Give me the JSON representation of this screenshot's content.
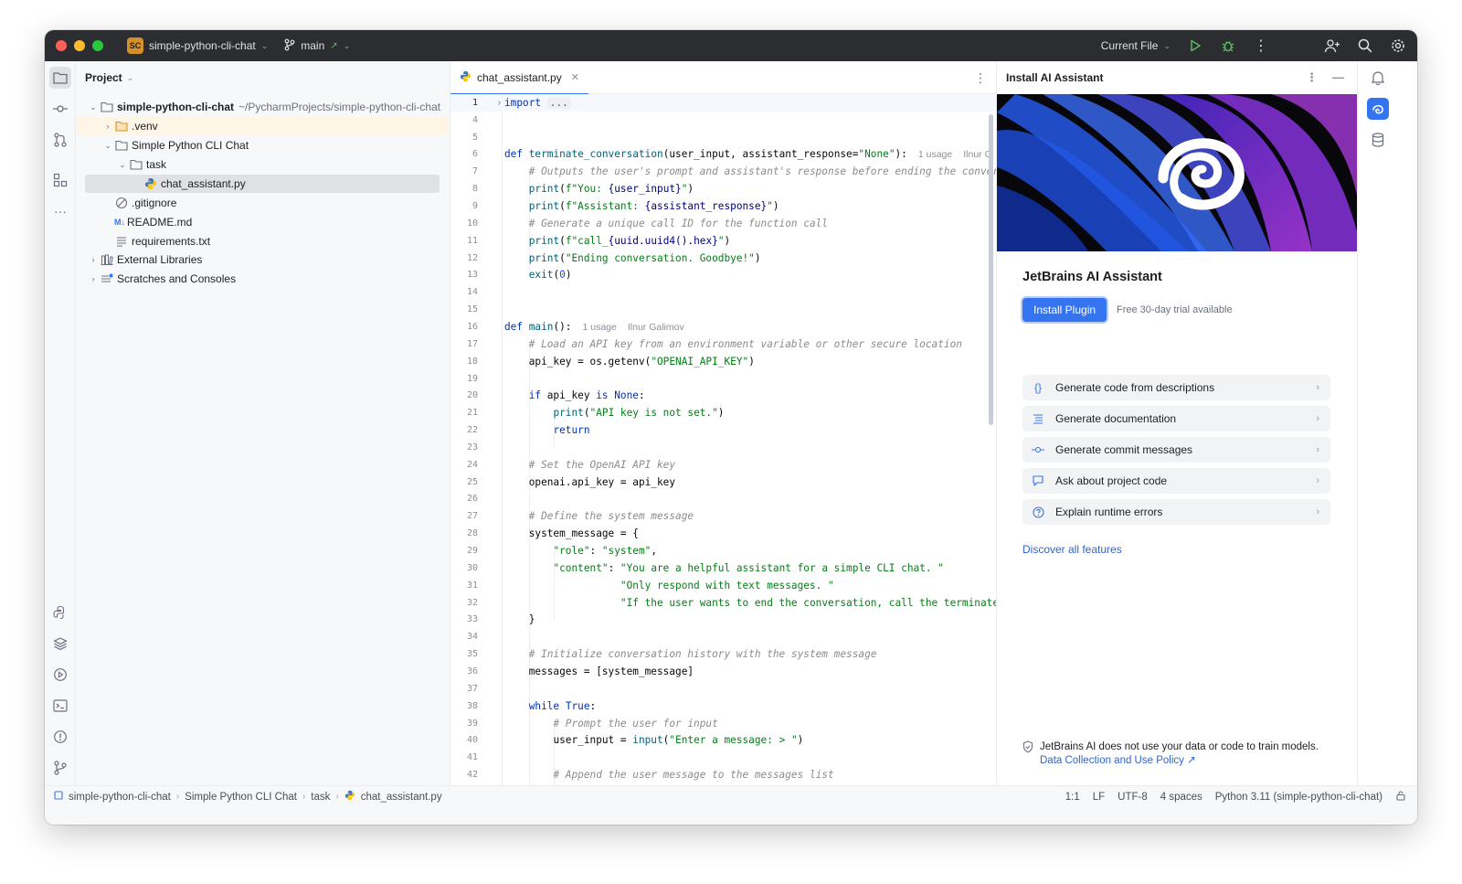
{
  "titlebar": {
    "project_badge": "SC",
    "project_name": "simple-python-cli-chat",
    "branch": "main",
    "run_config": "Current File"
  },
  "project_panel": {
    "title": "Project",
    "root_name": "simple-python-cli-chat",
    "root_path": "~/PycharmProjects/simple-python-cli-chat",
    "items": {
      "venv": ".venv",
      "folder_chat": "Simple Python CLI Chat",
      "folder_task": "task",
      "file_main": "chat_assistant.py",
      "gitignore": ".gitignore",
      "readme_prefix": "M↓",
      "readme": "README.md",
      "requirements": "requirements.txt",
      "external_libs": "External Libraries",
      "scratches": "Scratches and Consoles"
    }
  },
  "editor": {
    "tab_label": "chat_assistant.py",
    "hints": {
      "usage": "1 usage",
      "author": "Ilnur Galimov",
      "author_short": "Ilnur G"
    },
    "lines": {
      "n1": "1",
      "n4": "4",
      "n5": "5",
      "n6": "6",
      "n7": "7",
      "n8": "8",
      "n9": "9",
      "n10": "10",
      "n11": "11",
      "n12": "12",
      "n13": "13",
      "n14": "14",
      "n15": "15",
      "n16": "16",
      "n17": "17",
      "n18": "18",
      "n19": "19",
      "n20": "20",
      "n21": "21",
      "n22": "22",
      "n23": "23",
      "n24": "24",
      "n25": "25",
      "n26": "26",
      "n27": "27",
      "n28": "28",
      "n29": "29",
      "n30": "30",
      "n31": "31",
      "n32": "32",
      "n33": "33",
      "n34": "34",
      "n35": "35",
      "n36": "36",
      "n37": "37",
      "n38": "38",
      "n39": "39",
      "n40": "40",
      "n41": "41",
      "n42": "42"
    },
    "code": {
      "import_kw": "import",
      "import_fold": "...",
      "def": "def",
      "fn_terminate": "terminate_conversation",
      "terminate_params_a": "(user_input, assistant_response=",
      "none_str": "\"None\"",
      "terminate_params_b": "):",
      "c7": "# Outputs the user's prompt and assistant's response before ending the conversation",
      "print": "print",
      "l8_a": "(",
      "l8_str1": "f\"You: ",
      "l8_sp": "{user_input}",
      "l8_str2": "\"",
      "l8_b": ")",
      "l9_str1": "f\"Assistant: ",
      "l9_sp": "{assistant_response}",
      "c10": "# Generate a unique call ID for the function call",
      "l11_str1": "f\"call_",
      "l11_sp": "{uuid.uuid4().hex}",
      "l12_str": "\"Ending conversation. Goodbye!\"",
      "exit": "exit",
      "zero": "0",
      "fn_main": "main",
      "main_params": "():",
      "c17": "# Load an API key from an environment variable or other secure location",
      "l18_a": "api_key = os.getenv(",
      "l18_str": "\"OPENAI_API_KEY\"",
      "if": "if",
      "l20_a": " api_key ",
      "is": "is",
      "none": "None",
      "colon": ":",
      "l21_str": "\"API key is not set.\"",
      "return": "return",
      "c24": "# Set the OpenAI API key",
      "l25": "openai.api_key = api_key",
      "c27": "# Define the system message",
      "l28": "system_message = {",
      "l29_k": "\"role\"",
      "l29_sep": ": ",
      "l29_v": "\"system\"",
      "comma": ",",
      "l30_k": "\"content\"",
      "l30_v": "\"You are a helpful assistant for a simple CLI chat. \"",
      "l31_v": "\"Only respond with text messages. \"",
      "l32_v": "\"If the user wants to end the conversation, call the terminate_conversation function.\"",
      "l33": "}",
      "c35": "# Initialize conversation history with the system message",
      "l36": "messages = [system_message]",
      "while": "while",
      "true": "True",
      "c39": "# Prompt the user for input",
      "l40_a": "user_input = ",
      "input": "input",
      "l40_str": "\"Enter a message: > \"",
      "c42": "# Append the user message to the messages list"
    }
  },
  "ai_panel": {
    "header": "Install AI Assistant",
    "title": "JetBrains AI Assistant",
    "install_button": "Install Plugin",
    "trial": "Free 30-day trial available",
    "features": [
      {
        "label": "Generate code from descriptions",
        "icon": "braces-icon"
      },
      {
        "label": "Generate documentation",
        "icon": "doc-lines-icon"
      },
      {
        "label": "Generate commit messages",
        "icon": "commit-icon"
      },
      {
        "label": "Ask about project code",
        "icon": "chat-bubble-icon"
      },
      {
        "label": "Explain runtime errors",
        "icon": "question-circle-icon"
      }
    ],
    "discover": "Discover all features",
    "notice": "JetBrains AI does not use your data or code to train models.",
    "policy_link": "Data Collection and Use Policy ↗"
  },
  "statusbar": {
    "crumbs": [
      "simple-python-cli-chat",
      "Simple Python CLI Chat",
      "task",
      "chat_assistant.py"
    ],
    "position": "1:1",
    "line_sep": "LF",
    "encoding": "UTF-8",
    "indent": "4 spaces",
    "interpreter": "Python 3.11 (simple-python-cli-chat)"
  },
  "colors": {
    "accent": "#3574f0",
    "titlebar_bg": "#2b2d30",
    "keyword": "#0033b3",
    "string": "#067d17",
    "comment": "#8c8c8c"
  }
}
